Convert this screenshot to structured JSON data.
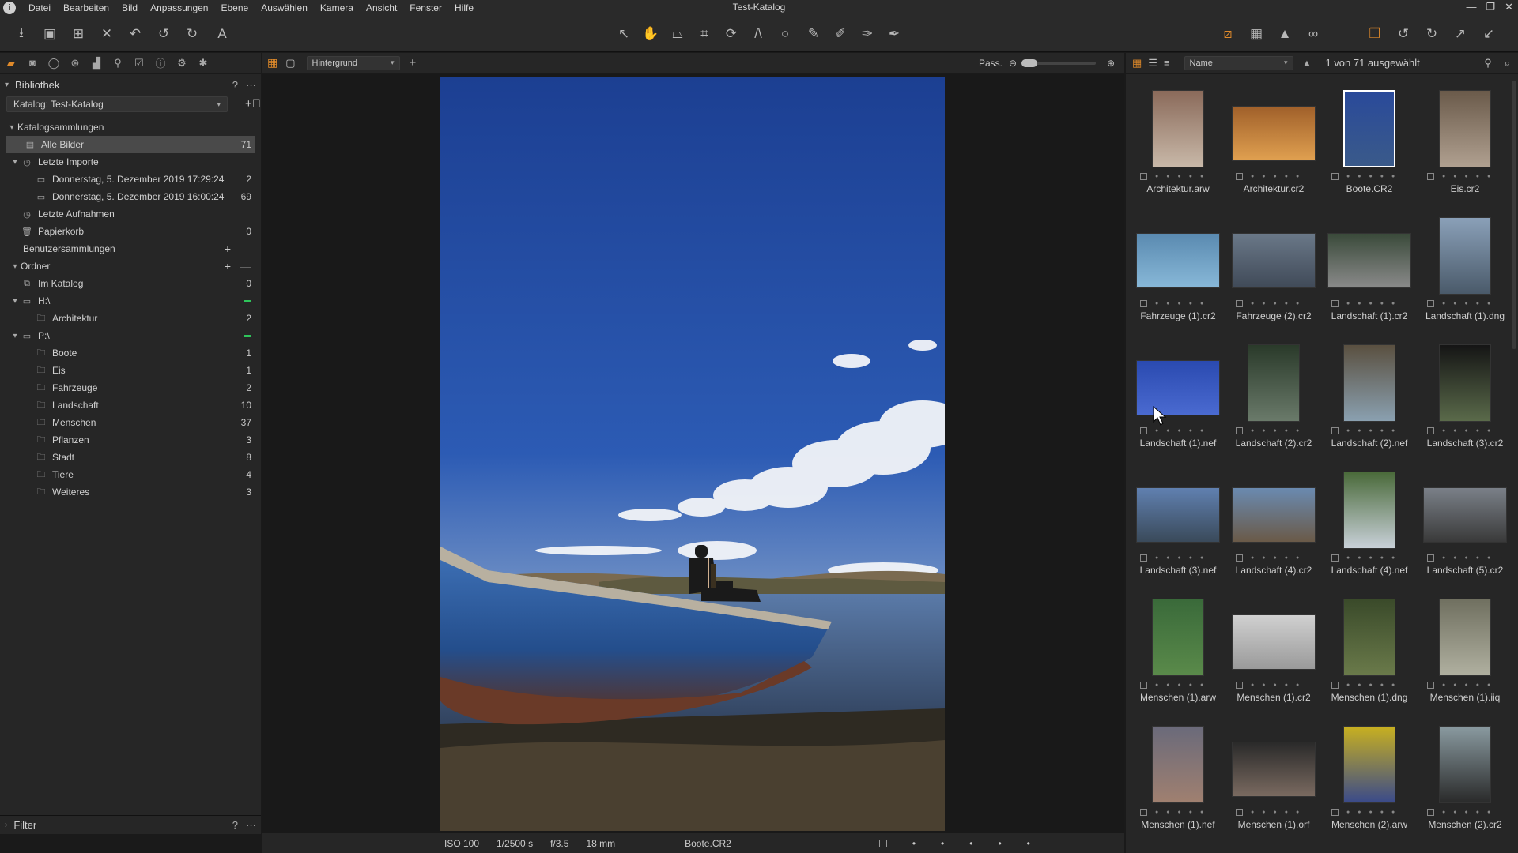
{
  "window": {
    "title": "Test-Katalog",
    "controls": [
      "—",
      "❐",
      "✕"
    ]
  },
  "menu": [
    "Datei",
    "Bearbeiten",
    "Bild",
    "Anpassungen",
    "Ebene",
    "Auswählen",
    "Kamera",
    "Ansicht",
    "Fenster",
    "Hilfe"
  ],
  "library": {
    "title": "Bibliothek",
    "catalog_select": "Katalog: Test-Katalog",
    "sections": {
      "catalog_collections": "Katalogsammlungen",
      "all_images": "Alle Bilder",
      "all_images_count": "71",
      "recent_imports": "Letzte Importe",
      "import1": "Donnerstag, 5. Dezember 2019 17:29:24",
      "import1_count": "2",
      "import2": "Donnerstag, 5. Dezember 2019 16:00:24",
      "import2_count": "69",
      "recent_captures": "Letzte Aufnahmen",
      "trash": "Papierkorb",
      "trash_count": "0",
      "user_collections": "Benutzersammlungen",
      "folders": "Ordner",
      "in_catalog": "Im Katalog",
      "in_catalog_count": "0",
      "drive_h": "H:\\",
      "architektur": "Architektur",
      "architektur_count": "2",
      "drive_p": "P:\\"
    },
    "subfolders": [
      {
        "label": "Boote",
        "count": "1"
      },
      {
        "label": "Eis",
        "count": "1"
      },
      {
        "label": "Fahrzeuge",
        "count": "2"
      },
      {
        "label": "Landschaft",
        "count": "10"
      },
      {
        "label": "Menschen",
        "count": "37"
      },
      {
        "label": "Pflanzen",
        "count": "3"
      },
      {
        "label": "Stadt",
        "count": "8"
      },
      {
        "label": "Tiere",
        "count": "4"
      },
      {
        "label": "Weiteres",
        "count": "3"
      }
    ],
    "filter": "Filter"
  },
  "viewer": {
    "layer_select": "Hintergrund",
    "fit_label": "Pass.",
    "status": {
      "iso": "ISO 100",
      "shutter": "1/2500 s",
      "aperture": "f/3.5",
      "focal": "18 mm",
      "filename": "Boote.CR2"
    }
  },
  "browser": {
    "sort_select": "Name",
    "selection_count": "1 von 71 ausgewählt",
    "thumbnails": [
      {
        "label": "Architektur.arw",
        "colors": [
          "#8a6a5a",
          "#c8b8a8"
        ],
        "orient": "p"
      },
      {
        "label": "Architektur.cr2",
        "colors": [
          "#a0602a",
          "#e0a050"
        ],
        "orient": "l"
      },
      {
        "label": "Boote.CR2",
        "colors": [
          "#2a4a9a",
          "#3a5a8a"
        ],
        "orient": "p",
        "selected": true
      },
      {
        "label": "Eis.cr2",
        "colors": [
          "#6a5a4a",
          "#b0a090"
        ],
        "orient": "p"
      },
      {
        "label": "Fahrzeuge (1).cr2",
        "colors": [
          "#5a8ab0",
          "#88b8d8"
        ],
        "orient": "l"
      },
      {
        "label": "Fahrzeuge (2).cr2",
        "colors": [
          "#6a7888",
          "#404a58"
        ],
        "orient": "l"
      },
      {
        "label": "Landschaft (1).cr2",
        "colors": [
          "#3a4a3a",
          "#8a8a8a"
        ],
        "orient": "l"
      },
      {
        "label": "Landschaft (1).dng",
        "colors": [
          "#8aa0b8",
          "#4a5a6a"
        ],
        "orient": "p"
      },
      {
        "label": "Landschaft (1).nef",
        "colors": [
          "#2a4ab0",
          "#4a6ad0"
        ],
        "orient": "l"
      },
      {
        "label": "Landschaft (2).cr2",
        "colors": [
          "#2a3a2a",
          "#6a7a6a"
        ],
        "orient": "p"
      },
      {
        "label": "Landschaft (2).nef",
        "colors": [
          "#5a5040",
          "#8aa0b0"
        ],
        "orient": "p"
      },
      {
        "label": "Landschaft (3).cr2",
        "colors": [
          "#151515",
          "#5a6a4a"
        ],
        "orient": "p"
      },
      {
        "label": "Landschaft (3).nef",
        "colors": [
          "#6080b0",
          "#3a4a5a"
        ],
        "orient": "l"
      },
      {
        "label": "Landschaft (4).cr2",
        "colors": [
          "#6a8ab0",
          "#6a5a48"
        ],
        "orient": "l"
      },
      {
        "label": "Landschaft (4).nef",
        "colors": [
          "#4a6a3a",
          "#c8d0d8"
        ],
        "orient": "p"
      },
      {
        "label": "Landschaft (5).cr2",
        "colors": [
          "#7a8088",
          "#3a3a3a"
        ],
        "orient": "l"
      },
      {
        "label": "Menschen (1).arw",
        "colors": [
          "#3a6a3a",
          "#5a8a4a"
        ],
        "orient": "p"
      },
      {
        "label": "Menschen (1).cr2",
        "colors": [
          "#d0d0d0",
          "#9a9a9a"
        ],
        "orient": "l"
      },
      {
        "label": "Menschen (1).dng",
        "colors": [
          "#3a4a2a",
          "#6a7a4a"
        ],
        "orient": "p"
      },
      {
        "label": "Menschen (1).iiq",
        "colors": [
          "#707060",
          "#b0b0a0"
        ],
        "orient": "p"
      },
      {
        "label": "Menschen (1).nef",
        "colors": [
          "#6a6a7a",
          "#a08070"
        ],
        "orient": "p"
      },
      {
        "label": "Menschen (1).orf",
        "colors": [
          "#2a2a2a",
          "#7a6a60"
        ],
        "orient": "l"
      },
      {
        "label": "Menschen (2).arw",
        "colors": [
          "#c8b020",
          "#3a4a8a"
        ],
        "orient": "p"
      },
      {
        "label": "Menschen (2).cr2",
        "colors": [
          "#8a9aa0",
          "#2a2a2a"
        ],
        "orient": "p"
      }
    ]
  }
}
